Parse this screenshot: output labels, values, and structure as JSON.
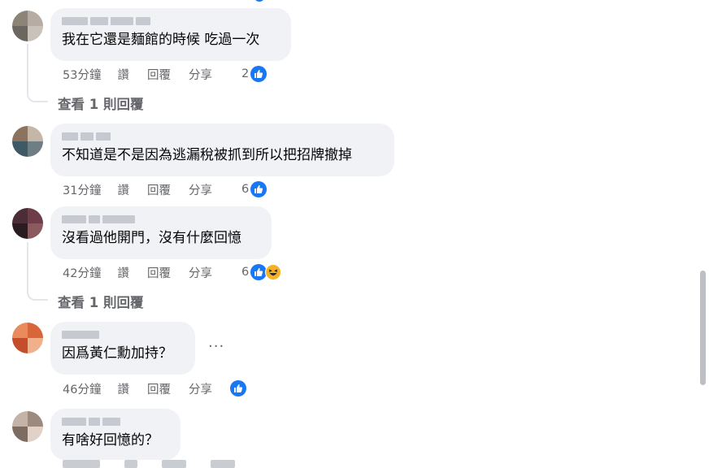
{
  "comments": [
    {
      "text": "我在它還是麵館的時候 吃過一次",
      "time": "53分鐘",
      "like": "讚",
      "reply": "回覆",
      "share": "分享",
      "reactions": "2",
      "avatar_colors": [
        "#8d8478",
        "#b6aca3",
        "#6c6660",
        "#c9c2bb"
      ]
    },
    {
      "text": "不知道是不是因為逃漏稅被抓到所以把招牌撤掉",
      "time": "31分鐘",
      "like": "讚",
      "reply": "回覆",
      "share": "分享",
      "reactions": "6",
      "avatar_colors": [
        "#3f5a66",
        "#6f7e84",
        "#8b7360",
        "#c5b7a8"
      ]
    },
    {
      "text": "沒看過他開門，沒有什麼回憶",
      "time": "42分鐘",
      "like": "讚",
      "reply": "回覆",
      "share": "分享",
      "reactions": "6",
      "avatar_colors": [
        "#4a2d36",
        "#6d3d49",
        "#2a1d22",
        "#8a5a5e"
      ]
    },
    {
      "text": "因爲黃仁勳加持？",
      "time": "46分鐘",
      "like": "讚",
      "reply": "回覆",
      "share": "分享",
      "reactions": "",
      "avatar_colors": [
        "#d9663a",
        "#e98b5c",
        "#c44e2b",
        "#f1b08c"
      ]
    },
    {
      "text": "有啥好回憶的？",
      "avatar_colors": [
        "#9c8a7e",
        "#c4b4a8",
        "#7c6c62",
        "#e0d2c7"
      ]
    }
  ],
  "view_replies": [
    "查看 1 則回覆",
    "查看 1 則回覆"
  ],
  "more_dots": "···",
  "colors": {
    "bubble": "#f0f2f5",
    "meta": "#65676b",
    "like_blue": "#1877f2",
    "haha_yellow": "#f7b125",
    "thread_line": "#e4e6eb",
    "scrollbar": "#bcc0c4"
  }
}
